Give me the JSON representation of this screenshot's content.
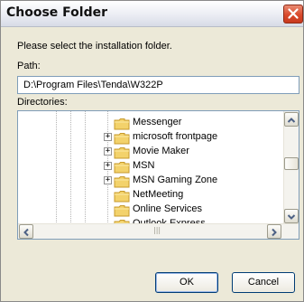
{
  "dialog": {
    "title": "Choose Folder",
    "instruction": "Please select the installation folder.",
    "path_label": "Path:",
    "path_value": "D:\\Program Files\\Tenda\\W322P",
    "directories_label": "Directories:"
  },
  "tree": {
    "items": [
      {
        "label": "Messenger",
        "expandable": false
      },
      {
        "label": "microsoft frontpage",
        "expandable": true
      },
      {
        "label": "Movie Maker",
        "expandable": true
      },
      {
        "label": "MSN",
        "expandable": true
      },
      {
        "label": "MSN Gaming Zone",
        "expandable": true
      },
      {
        "label": "NetMeeting",
        "expandable": false
      },
      {
        "label": "Online Services",
        "expandable": false
      },
      {
        "label": "Outlook Express",
        "expandable": false
      }
    ]
  },
  "buttons": {
    "ok": "OK",
    "cancel": "Cancel"
  },
  "colors": {
    "dialog_bg": "#ece9d8",
    "close_button": "#d9492b",
    "folder_yellow": "#f3d26b"
  },
  "icons": {
    "close": "close-icon",
    "folder": "folder-icon",
    "expand": "plus-box-icon",
    "scroll_up": "arrow-up-icon",
    "scroll_down": "arrow-down-icon",
    "scroll_left": "arrow-left-icon",
    "scroll_right": "arrow-right-icon"
  }
}
